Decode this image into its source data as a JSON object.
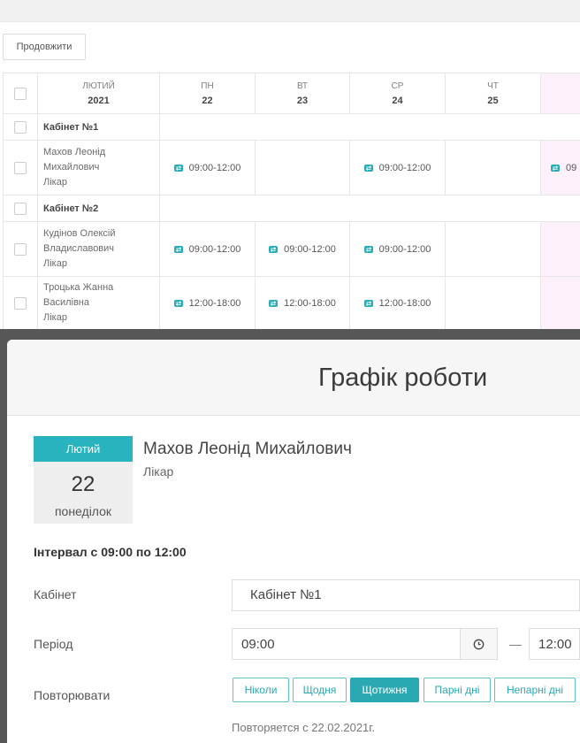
{
  "toolbar": {
    "continue_label": "Продовжити"
  },
  "schedule": {
    "header": {
      "month": "ЛЮТИЙ",
      "year": "2021",
      "days": [
        {
          "dow": "ПН",
          "date": "22"
        },
        {
          "dow": "ВТ",
          "date": "23"
        },
        {
          "dow": "СР",
          "date": "24"
        },
        {
          "dow": "ЧТ",
          "date": "25"
        }
      ]
    },
    "groups": [
      {
        "name": "Кабінет №1",
        "rows": [
          {
            "name_lines": [
              "Махов Леонід",
              "Михайлович"
            ],
            "role": "Лікар",
            "slots": [
              "09:00-12:00",
              "",
              "09:00-12:00",
              "",
              "09"
            ]
          }
        ]
      },
      {
        "name": "Кабінет №2",
        "rows": [
          {
            "name_lines": [
              "Кудінов Олексій",
              "Владиславович"
            ],
            "role": "Лікар",
            "slots": [
              "09:00-12:00",
              "09:00-12:00",
              "09:00-12:00",
              "",
              ""
            ]
          },
          {
            "name_lines": [
              "Троцька Жанна",
              "Василівна"
            ],
            "role": "Лікар",
            "slots": [
              "12:00-18:00",
              "12:00-18:00",
              "12:00-18:00",
              "",
              ""
            ]
          }
        ]
      }
    ]
  },
  "modal": {
    "title": "Графік роботи",
    "date_card": {
      "month": "Лютий",
      "day": "22",
      "weekday": "понеділок"
    },
    "person": {
      "name": "Махов Леонід Михайлович",
      "role": "Лікар"
    },
    "interval_text": "Інтервал с 09:00 по 12:00",
    "form": {
      "cabinet": {
        "label": "Кабінет",
        "value": "Кабінет №1"
      },
      "period": {
        "label": "Період",
        "start": "09:00",
        "separator": "—",
        "end": "12:00"
      },
      "repeat": {
        "label": "Повторювати",
        "options": [
          "Ніколи",
          "Щодня",
          "Щотижня",
          "Парні дні",
          "Непарні дні"
        ],
        "selected": "Щотижня"
      },
      "repeat_note": "Повторяется с 22.02.2021г."
    }
  },
  "colors": {
    "accent": "#2aa9b3",
    "date_card_header": "#29b3be",
    "highlight_column": "#fcf0fa",
    "overlay": "#575757"
  },
  "icons": {
    "time_slot": "repeat-icon",
    "time_picker": "clock-icon"
  }
}
